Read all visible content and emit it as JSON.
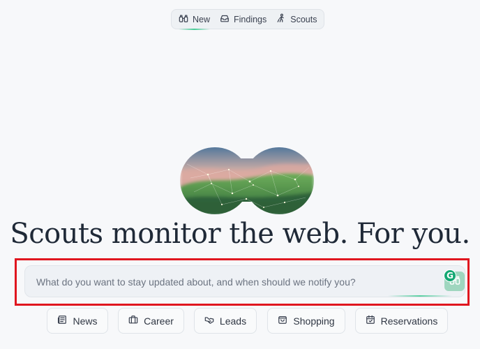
{
  "nav": {
    "tabs": [
      {
        "label": "New",
        "icon": "binoculars-icon",
        "active": true
      },
      {
        "label": "Findings",
        "icon": "inbox-icon",
        "active": false
      },
      {
        "label": "Scouts",
        "icon": "scouts-icon",
        "active": false
      }
    ]
  },
  "hero": {
    "headline": "Scouts monitor the web. For you."
  },
  "query": {
    "placeholder": "What do you want to stay updated about, and when should we notify you?",
    "value": ""
  },
  "grammarly": {
    "badge": "G"
  },
  "suggestions": [
    {
      "label": "News",
      "icon": "newspaper-icon"
    },
    {
      "label": "Career",
      "icon": "briefcase-icon"
    },
    {
      "label": "Leads",
      "icon": "handshake-icon"
    },
    {
      "label": "Shopping",
      "icon": "shopping-bag-icon"
    },
    {
      "label": "Reservations",
      "icon": "calendar-icon"
    }
  ],
  "colors": {
    "accent": "#34c78c",
    "highlight_frame": "#e0161f",
    "background": "#f7f8fa"
  }
}
